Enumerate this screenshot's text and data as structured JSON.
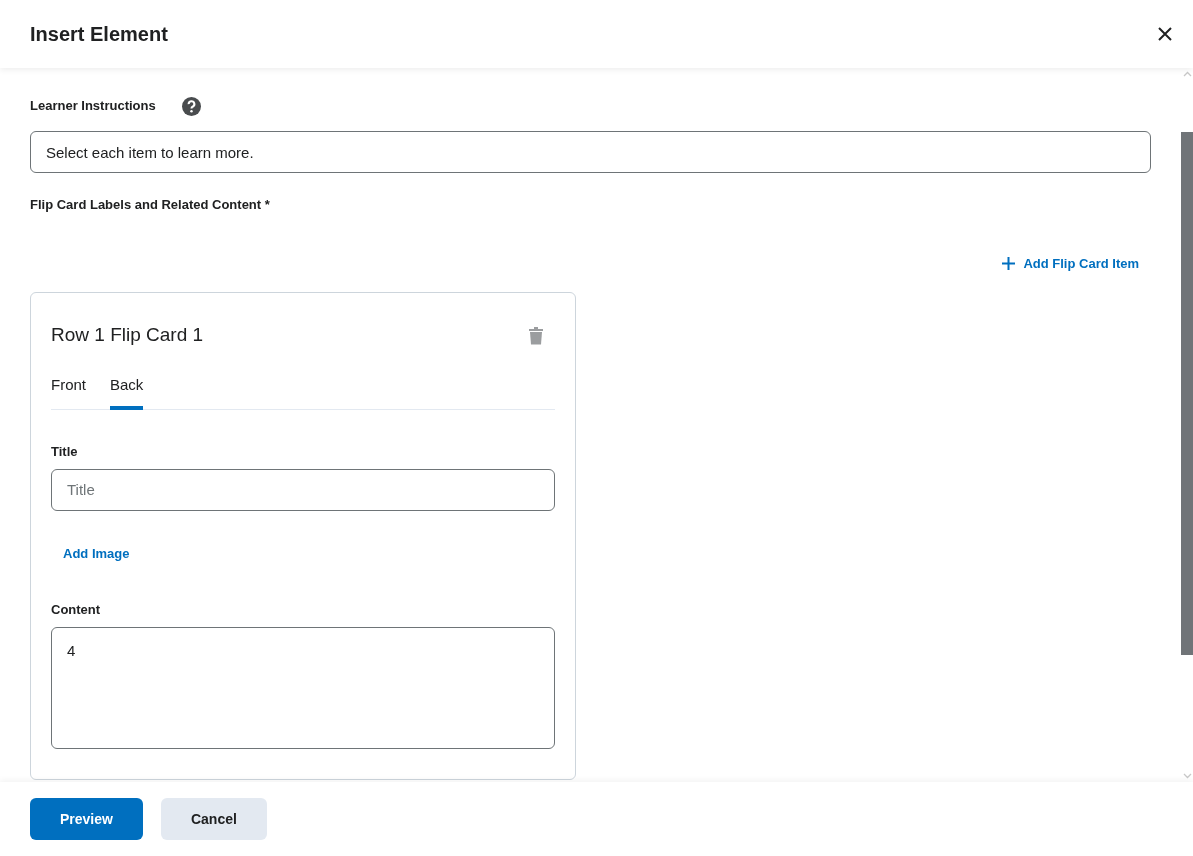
{
  "dialog": {
    "title": "Insert Element"
  },
  "learner_instructions": {
    "label": "Learner Instructions",
    "value": "Select each item to learn more."
  },
  "flip_cards": {
    "label": "Flip Card Labels and Related Content *",
    "add_button": "Add Flip Card Item",
    "cards": [
      {
        "title": "Row 1 Flip Card 1",
        "tabs": [
          {
            "label": "Front",
            "selected": false
          },
          {
            "label": "Back",
            "selected": true
          }
        ],
        "title_field": {
          "label": "Title",
          "placeholder": "Title"
        },
        "add_image": "Add Image",
        "content": {
          "label": "Content",
          "value": "4"
        }
      }
    ]
  },
  "footer": {
    "buttons": [
      {
        "label": "Preview",
        "kind": "primary"
      },
      {
        "label": "Cancel",
        "kind": "secondary"
      }
    ]
  }
}
